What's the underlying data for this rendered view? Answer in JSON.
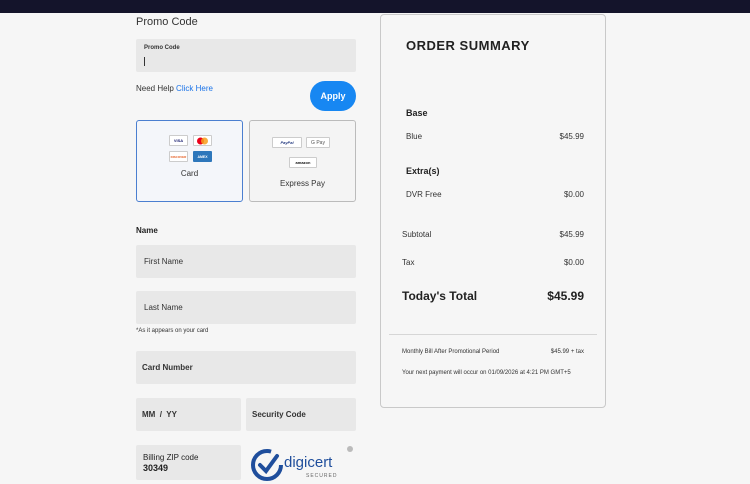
{
  "promo": {
    "section_label": "Promo Code",
    "field_label": "Promo Code",
    "value": "",
    "help_text": "Need Help",
    "help_link": "Click Here",
    "apply_label": "Apply"
  },
  "payment_methods": {
    "card": {
      "label": "Card",
      "logos": [
        "VISA",
        "mastercard-logo",
        "DISCOVER",
        "AMEX"
      ]
    },
    "express": {
      "label": "Express Pay",
      "logos": [
        "PayPal",
        "G Pay",
        "amazon"
      ]
    }
  },
  "billing": {
    "section_label": "Name",
    "first_name_placeholder": "First Name",
    "last_name_placeholder": "Last Name",
    "name_hint": "*As it appears on your card",
    "card_number_placeholder": "Card Number",
    "expiry_placeholder": "MM  /  YY",
    "security_code_placeholder": "Security Code",
    "zip_label": "Billing ZIP code",
    "zip_value": "30349"
  },
  "badge": {
    "name": "digicert",
    "sub": "SECURED"
  },
  "summary": {
    "title": "ORDER SUMMARY",
    "base_heading": "Base",
    "base_item": {
      "name": "Blue",
      "price": "$45.99"
    },
    "extras_heading": "Extra(s)",
    "extra_item": {
      "name": "DVR Free",
      "price": "$0.00"
    },
    "subtotal": {
      "label": "Subtotal",
      "value": "$45.99"
    },
    "tax": {
      "label": "Tax",
      "value": "$0.00"
    },
    "total": {
      "label": "Today's Total",
      "value": "$45.99"
    },
    "monthly": {
      "label": "Monthly Bill After Promotional Period",
      "value": "$45.99 + tax"
    },
    "next_payment": "Your next payment will occur on 01/09/2026 at 4:21 PM GMT+5"
  },
  "colors": {
    "accent": "#1787f2",
    "card_border": "#4b7fd0",
    "topbar": "#14142b"
  }
}
